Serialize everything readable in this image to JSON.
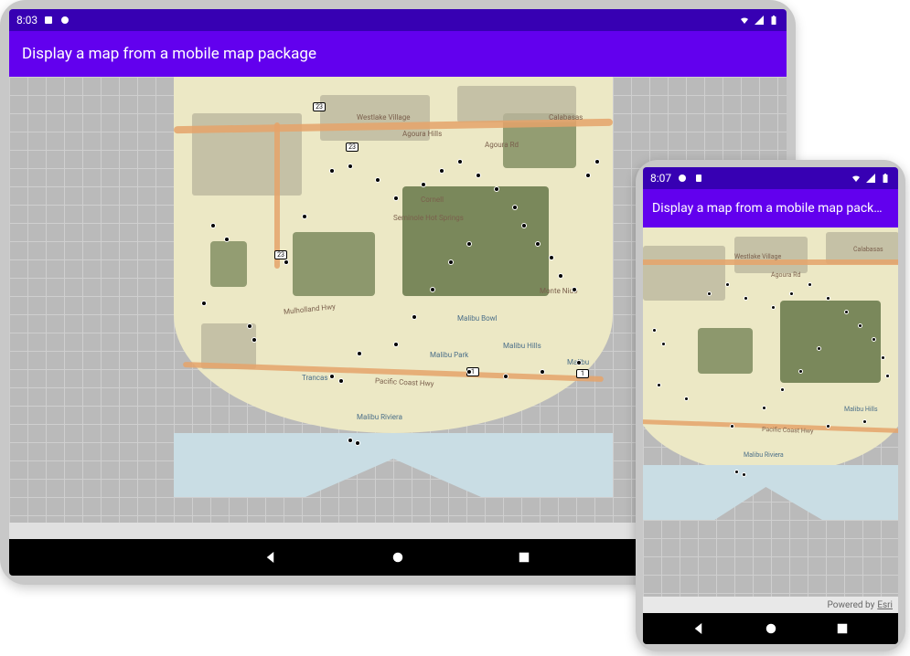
{
  "colors": {
    "status_bar": "#3700B3",
    "app_bar": "#6200EE",
    "land": "#ece8c5",
    "vegetation": "#6e7d4f",
    "ocean": "#c9dde4",
    "road": "#e5a36a"
  },
  "tablet": {
    "status": {
      "time": "8:03"
    },
    "app_title": "Display a map from a mobile map package",
    "attribution_prefix": "Powered by",
    "attribution_link": "Esri"
  },
  "phone": {
    "status": {
      "time": "8:07"
    },
    "app_title": "Display a map from a mobile map pack…",
    "attribution_prefix": "Powered by",
    "attribution_link": "Esri"
  },
  "map": {
    "route_shields": [
      "23",
      "23",
      "23",
      "1",
      "1"
    ],
    "labels": {
      "westlake": "Westlake Village",
      "agoura_hills": "Agoura Hills",
      "calabasas": "Calabasas",
      "agoura_rd": "Agoura Rd",
      "cornell": "Cornell",
      "seminole_springs": "Seminole Hot Springs",
      "monte_nido": "Monte Nido",
      "malibu_bowl": "Malibu Bowl",
      "malibu_hills": "Malibu Hills",
      "malibu": "Malibu",
      "trancas": "Trancas",
      "malibu_park": "Malibu Park",
      "malibu_riviera": "Malibu Riviera",
      "pch": "Pacific Coast Hwy",
      "mulholland": "Mulholland Hwy"
    }
  }
}
